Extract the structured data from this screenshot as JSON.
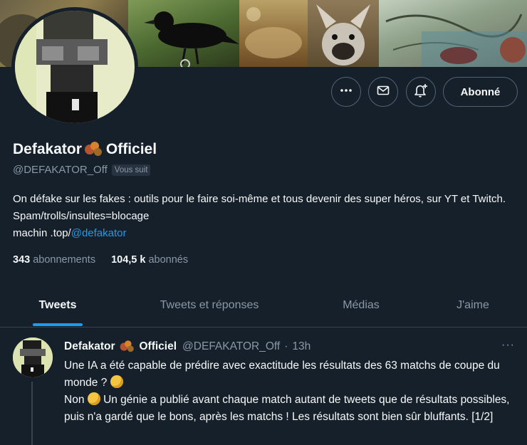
{
  "profile": {
    "display_name": "Defakator",
    "display_name_suffix": "Officiel",
    "name_emoji": "chestnut-balls-emoji",
    "handle": "@DEFAKATOR_Off",
    "follows_you_badge": "Vous suit",
    "bio_line1": "On défake sur les fakes : outils pour le faire soi-même et tous devenir des super héros, sur YT et Twitch. Spam/trolls/insultes=blocage",
    "bio_line2_prefix": "machin .top/",
    "bio_link": "@defakator",
    "following_count": "343",
    "following_label": "abonnements",
    "followers_count": "104,5 k",
    "followers_label": "abonnés"
  },
  "actions": {
    "more_icon": "more-icon",
    "message_icon": "mail-icon",
    "notify_icon": "bell-plus-icon",
    "follow_label": "Abonné"
  },
  "tabs": [
    {
      "label": "Tweets",
      "active": true
    },
    {
      "label": "Tweets et réponses",
      "active": false
    },
    {
      "label": "Médias",
      "active": false
    },
    {
      "label": "J'aime",
      "active": false
    }
  ],
  "tweet": {
    "author_name": "Defakator",
    "author_suffix": "Officiel",
    "handle": "@DEFAKATOR_Off",
    "separator": "·",
    "time": "13h",
    "more": "···",
    "line1": "Une IA a été capable de prédire avec exactitude les résultats des 63 matchs de coupe du monde ?",
    "line1_emoji": "thinking-monocle-emoji",
    "line2_start": "Non",
    "line2_emoji": "wink-emoji",
    "line2_rest": "Un génie a publié avant chaque match autant de tweets que de résultats possibles, puis n'a gardé que le bons, après les matchs ! Les résultats sont bien sûr bluffants. [1/2]"
  },
  "colors": {
    "background": "#15202b",
    "text": "#f7f9f9",
    "muted": "#8b98a5",
    "accent": "#1d9bf0",
    "border": "#38444d"
  }
}
